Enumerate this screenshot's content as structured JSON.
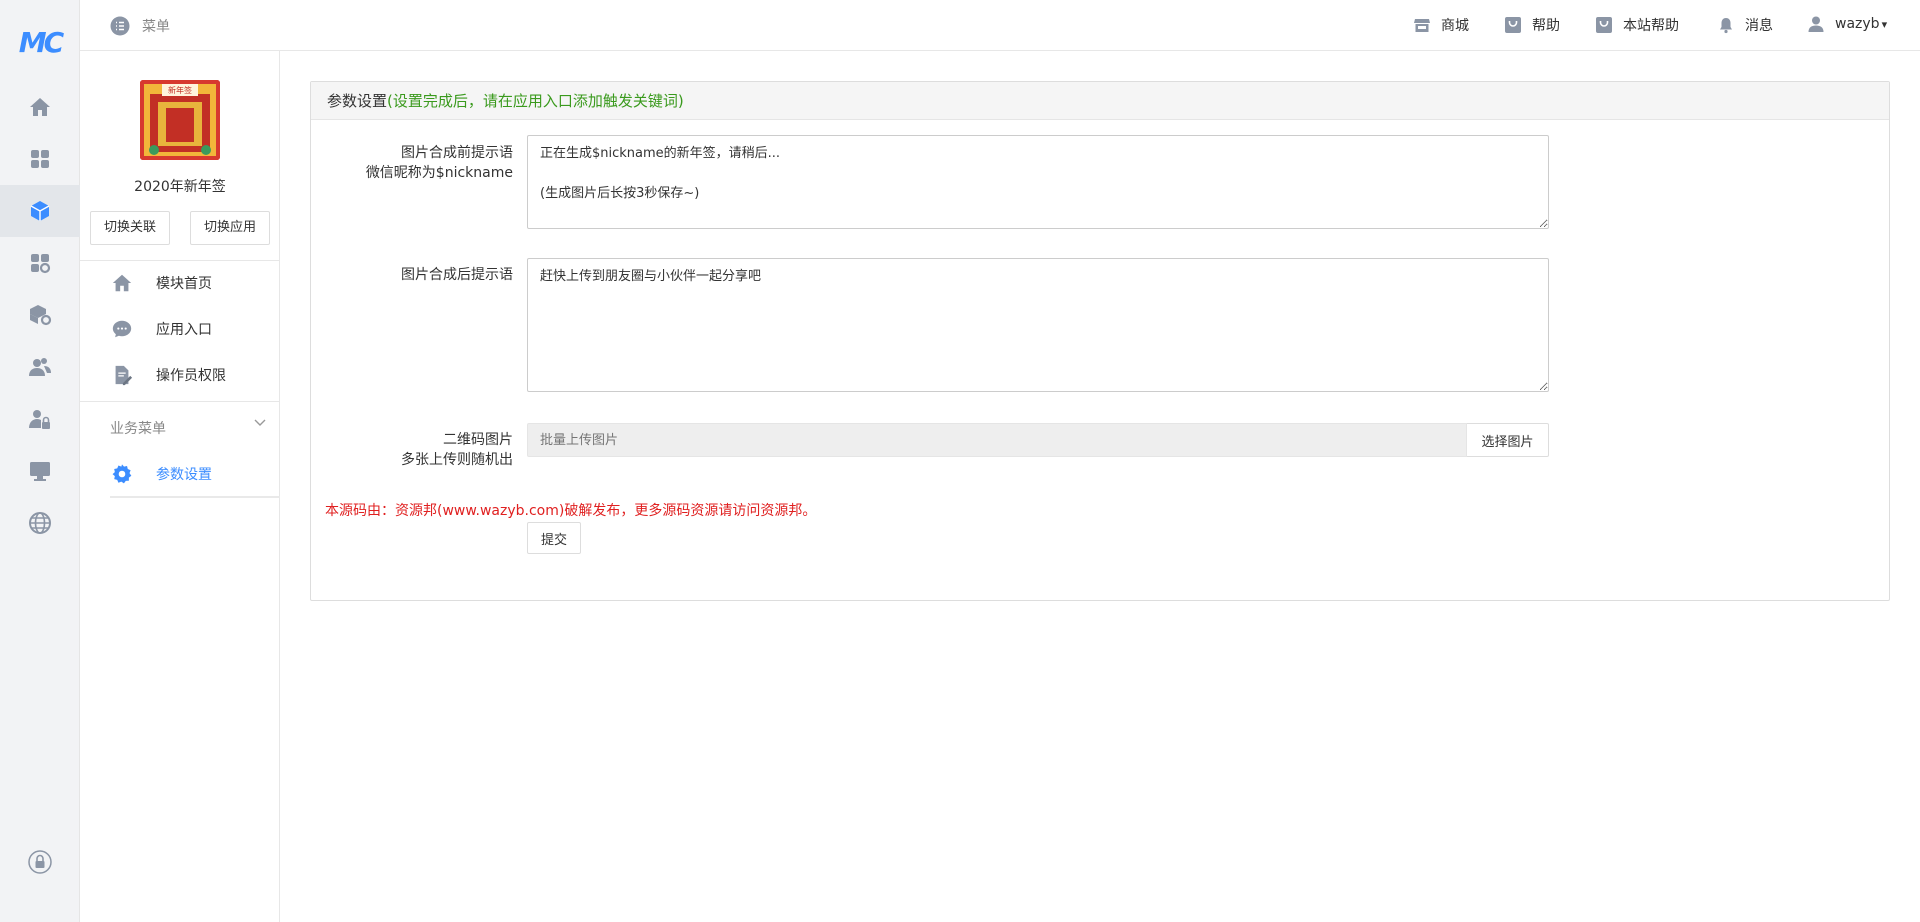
{
  "topbar": {
    "menu_label": "菜单",
    "links": [
      {
        "label": "商城",
        "icon": "store-icon"
      },
      {
        "label": "帮助",
        "icon": "help-bag-icon"
      },
      {
        "label": "本站帮助",
        "icon": "site-help-bag-icon"
      },
      {
        "label": "消息",
        "icon": "bell-icon"
      }
    ],
    "user": "wazyb",
    "user_caret": "▾"
  },
  "rail": {
    "logo": "MC",
    "items": [
      "home-icon",
      "apps-grid-icon",
      "module-cube-icon",
      "app-settings-icon",
      "package-settings-icon",
      "users-icon",
      "user-lock-icon",
      "monitor-icon",
      "globe-icon"
    ],
    "active_index": 2,
    "bottom_icon": "lock-icon"
  },
  "sidebar": {
    "app_name": "2020年新年签",
    "avatar_text": "新年签",
    "buttons": {
      "switch_link": "切换关联",
      "switch_app": "切换应用"
    },
    "nav": [
      {
        "label": "模块首页",
        "icon": "home-icon"
      },
      {
        "label": "应用入口",
        "icon": "chat-icon"
      },
      {
        "label": "操作员权限",
        "icon": "document-edit-icon"
      }
    ],
    "section_title": "业务菜单",
    "section_items": [
      {
        "label": "参数设置",
        "icon": "gear-icon",
        "active": true
      }
    ]
  },
  "panel": {
    "title": "参数设置",
    "title_note": "(设置完成后，请在应用入口添加触发关键词)",
    "fields": {
      "before": {
        "label_line1": "图片合成前提示语",
        "label_line2": "微信昵称为$nickname",
        "value": "正在生成$nickname的新年签，请稍后...\n\n(生成图片后长按3秒保存~)"
      },
      "after": {
        "label_line1": "图片合成后提示语",
        "value": "赶快上传到朋友圈与小伙伴一起分享吧"
      },
      "qrcode": {
        "label_line1": "二维码图片",
        "label_line2": "多张上传则随机出",
        "placeholder": "批量上传图片",
        "button": "选择图片"
      }
    },
    "notice": "本源码由：资源邦(www.wazyb.com)破解发布，更多源码资源请访问资源邦。",
    "submit": "提交"
  }
}
